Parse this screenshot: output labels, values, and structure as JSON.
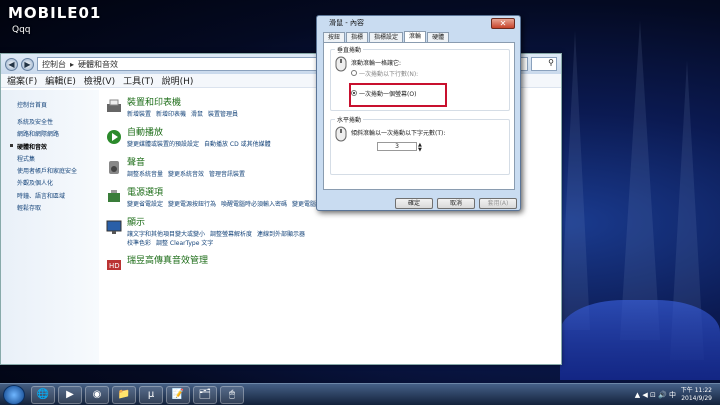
{
  "watermark": {
    "brand": "MOBILE01",
    "user": "Qqq"
  },
  "explorer": {
    "nav_back": "◀",
    "nav_fwd": "▶",
    "breadcrumb": [
      "控制台",
      "硬體和音效"
    ],
    "menu": [
      "檔案(F)",
      "編輯(E)",
      "檢視(V)",
      "工具(T)",
      "說明(H)"
    ],
    "left_nav": [
      "控制台首頁",
      "系統及安全性",
      "網路和網際網路",
      "硬體和音效",
      "程式集",
      "使用者帳戶和家庭安全",
      "外觀及個人化",
      "時鐘、語言和區域",
      "輕鬆存取"
    ],
    "categories": [
      {
        "title": "裝置和印表機",
        "links": [
          "新增裝置",
          "新增印表機",
          "滑鼠",
          "裝置管理員"
        ]
      },
      {
        "title": "自動播放",
        "links": [
          "變更媒體或裝置的預設設定",
          "自動播放 CD 或其他媒體"
        ]
      },
      {
        "title": "聲音",
        "links": [
          "調整系統音量",
          "變更系統音效",
          "管理音訊裝置"
        ]
      },
      {
        "title": "電源選項",
        "links": [
          "變更省電設定",
          "變更電源按鈕行為",
          "喚醒電腦時必須輸入密碼",
          "變更電腦"
        ]
      },
      {
        "title": "顯示",
        "links": [
          "讓文字和其他項目變大或變小",
          "調整螢幕解析度",
          "連線到外部顯示器",
          "校準色彩",
          "調整 ClearType 文字"
        ]
      },
      {
        "title": "瑞昱高傳真音效管理",
        "links": []
      }
    ]
  },
  "dialog": {
    "title": "滑鼠 - 內容",
    "tabs": [
      "按鈕",
      "指標",
      "指標設定",
      "滾輪",
      "硬體"
    ],
    "active_tab": "滾輪",
    "vertical": {
      "group_label": "垂直捲動",
      "desc": "滾動滾輪一格讓它:",
      "opt_lines": "一次捲動以下行數(N):",
      "opt_screen": "一次捲動一個螢幕(O)",
      "selected": "opt_screen"
    },
    "horizontal": {
      "group_label": "水平捲動",
      "desc": "傾斜滾輪以一次捲動以下字元數(T):",
      "value": "3"
    },
    "buttons": {
      "ok": "確定",
      "cancel": "取消",
      "apply": "套用(A)"
    },
    "close": "✕"
  },
  "taskbar": {
    "apps": [
      "🌐",
      "▶",
      "◉",
      "📁",
      "µ",
      "📝",
      "🗂",
      "🖱"
    ],
    "tray": "▲ ◀ ⊡ 🔊 中",
    "time": "下午 11:22",
    "date": "2014/9/29"
  },
  "colors": {
    "highlight": "#c8102e",
    "accent": "#1d6d18",
    "link": "#15447a"
  }
}
